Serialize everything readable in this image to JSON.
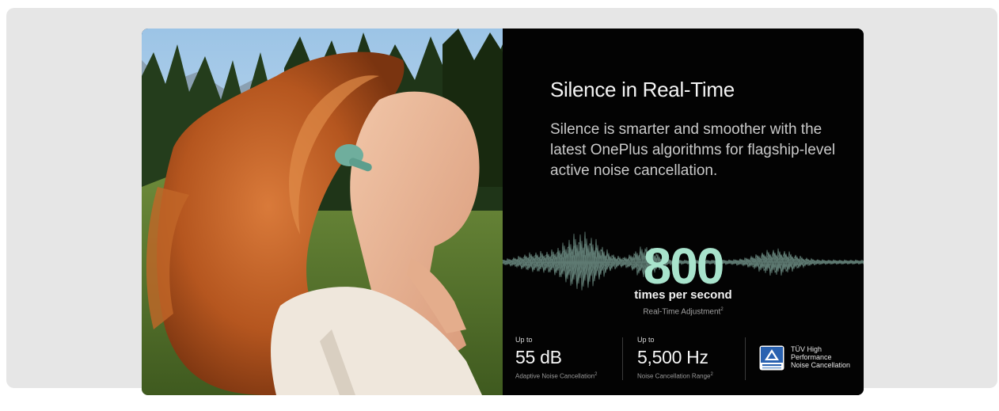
{
  "colors": {
    "page_frame": "#e6e6e6",
    "panel_bg": "#030303",
    "accent_green": "#a8e3cc"
  },
  "hero_image": {
    "description_icon": "woman-with-earbud-photo"
  },
  "content": {
    "title": "Silence in Real-Time",
    "description": "Silence is smarter and smoother with the latest OnePlus algorithms for flagship-level active noise cancellation.",
    "headline_stat": {
      "value": "800",
      "caption": "times per second",
      "sublabel": "Real-Time Adjustment",
      "footnote": "2"
    },
    "stats": [
      {
        "prefix": "Up to",
        "value": "55 dB",
        "label": "Adaptive Noise Cancellation",
        "footnote": "2"
      },
      {
        "prefix": "Up to",
        "value": "5,500 Hz",
        "label": "Noise Cancellation Range",
        "footnote": "2"
      }
    ],
    "certification": {
      "icon": "tuv-rheinland-badge-icon",
      "lines": [
        "TÜV High",
        "Performance",
        "Noise Cancellation"
      ]
    }
  }
}
